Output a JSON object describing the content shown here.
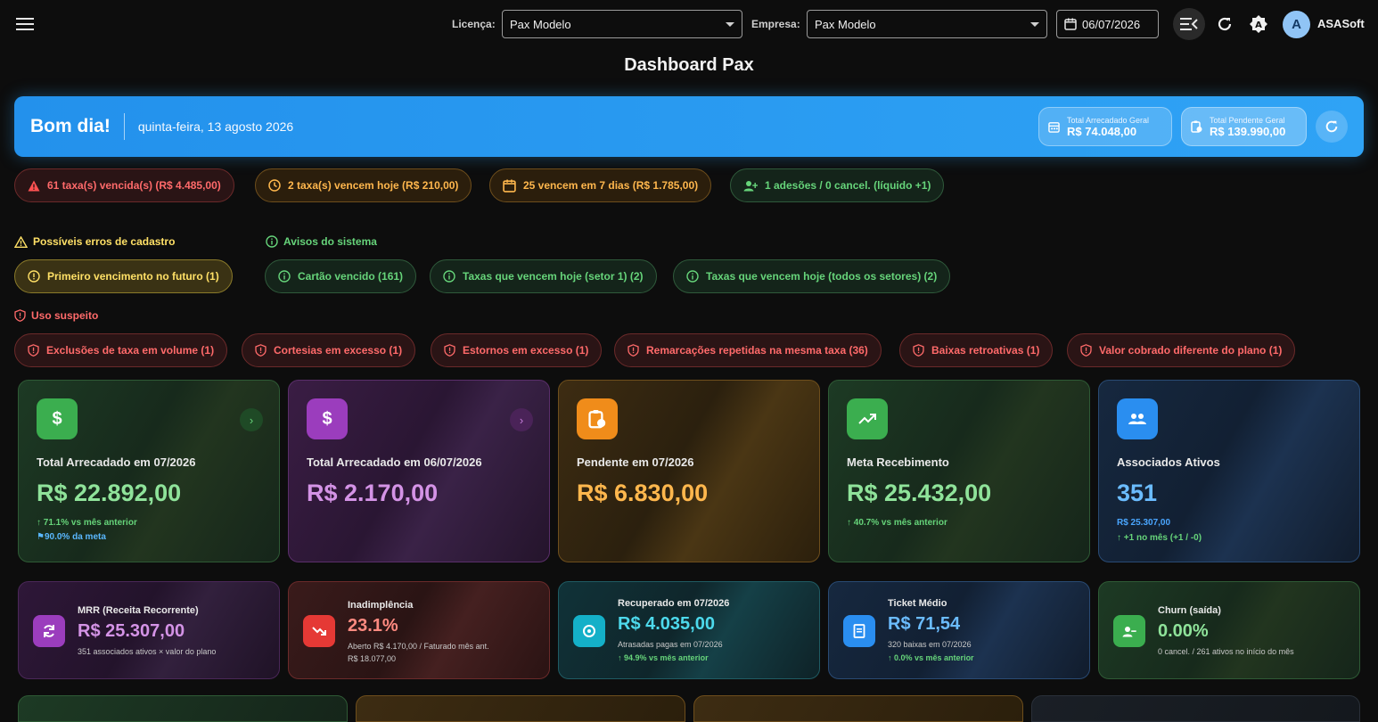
{
  "topbar": {
    "licenca_label": "Licença:",
    "licenca_value": "Pax Modelo",
    "empresa_label": "Empresa:",
    "empresa_value": "Pax Modelo",
    "date": "06/07/2026",
    "avatar_letter": "A",
    "user_name": "ASASoft"
  },
  "page": {
    "title": "Dashboard Pax"
  },
  "hero": {
    "greeting": "Bom dia!",
    "date_text": "quinta-feira, 13 agosto 2026",
    "total_arrecadado_label": "Total Arrecadado Geral",
    "total_arrecadado_value": "R$ 74.048,00",
    "total_pendente_label": "Total Pendente Geral",
    "total_pendente_value": "R$ 139.990,00"
  },
  "alerts": [
    "61 taxa(s) vencida(s) (R$ 4.485,00)",
    "2 taxa(s) vencem hoje (R$ 210,00)",
    "25 vencem em 7 dias (R$ 1.785,00)",
    "1 adesões / 0 cancel. (líquido +1)"
  ],
  "sections": {
    "cadastro_title": "Possíveis erros de cadastro",
    "cadastro_items": [
      "Primeiro vencimento no futuro (1)"
    ],
    "avisos_title": "Avisos do sistema",
    "avisos_items": [
      "Cartão vencido (161)",
      "Taxas que vencem hoje (setor 1) (2)",
      "Taxas que vencem hoje (todos os setores) (2)"
    ],
    "suspeito_title": "Uso suspeito",
    "suspeito_items": [
      "Exclusões de taxa em volume (1)",
      "Cortesias em excesso (1)",
      "Estornos em excesso (1)",
      "Remarcações repetidas na mesma taxa (36)",
      "Baixas retroativas (1)",
      "Valor cobrado diferente do plano (1)"
    ]
  },
  "kpi_cards": [
    {
      "label": "Total Arrecadado em 07/2026",
      "value": "R$ 22.892,00",
      "sub1": "71.1% vs mês anterior",
      "sub2": "90.0% da meta"
    },
    {
      "label": "Total Arrecadado em 06/07/2026",
      "value": "R$ 2.170,00"
    },
    {
      "label": "Pendente em 07/2026",
      "value": "R$ 6.830,00"
    },
    {
      "label": "Meta Recebimento",
      "value": "R$ 25.432,00",
      "sub1": "40.7% vs mês anterior"
    },
    {
      "label": "Associados Ativos",
      "value": "351",
      "sub1": "R$ 25.307,00",
      "sub2": "+1 no mês (+1 / -0)"
    }
  ],
  "small_cards": [
    {
      "label": "MRR (Receita Recorrente)",
      "value": "R$ 25.307,00",
      "sub1": "351 associados ativos × valor do plano"
    },
    {
      "label": "Inadimplência",
      "value": "23.1%",
      "sub1": "Aberto R$ 4.170,00 / Faturado mês ant.",
      "sub2": "R$ 18.077,00"
    },
    {
      "label": "Recuperado em 07/2026",
      "value": "R$ 4.035,00",
      "sub1": "Atrasadas pagas em 07/2026",
      "sub2": "94.9% vs mês anterior"
    },
    {
      "label": "Ticket Médio",
      "value": "R$ 71,54",
      "sub1": "320 baixas em 07/2026",
      "sub2": "0.0% vs mês anterior"
    },
    {
      "label": "Churn (saída)",
      "value": "0.00%",
      "sub1": "0 cancel. / 261 ativos no início do mês"
    }
  ],
  "colors": {
    "accent_blue": "#2fa3f5",
    "green": "#66d47a",
    "red": "#ff6a6a",
    "orange": "#ffb74d",
    "purple": "#c77ddb"
  }
}
